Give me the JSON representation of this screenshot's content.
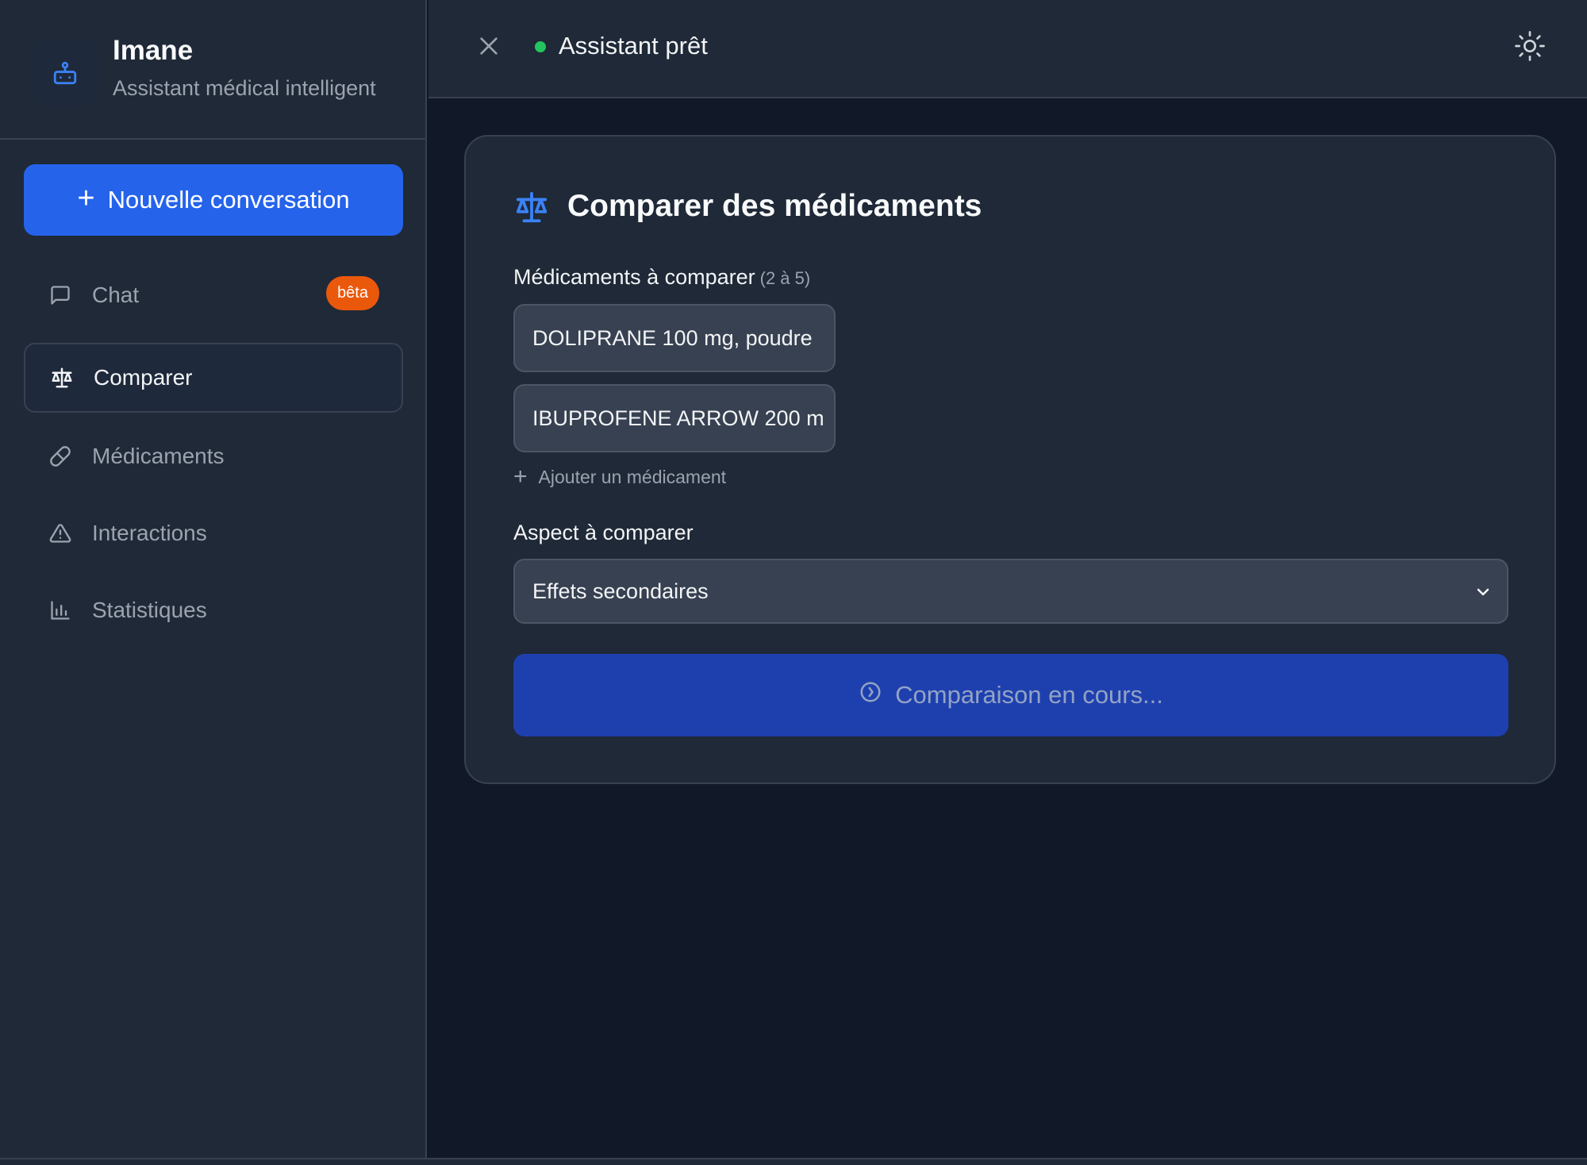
{
  "brand": {
    "name": "Imane",
    "subtitle": "Assistant médical intelligent",
    "logo_icon": "robot-icon"
  },
  "sidebar": {
    "new_button_label": "Nouvelle conversation",
    "items": [
      {
        "label": "Chat",
        "icon": "chat-bubble-icon",
        "badge": "bêta",
        "active": false
      },
      {
        "label": "Comparer",
        "icon": "scale-icon",
        "active": true
      },
      {
        "label": "Médicaments",
        "icon": "pill-icon",
        "active": false
      },
      {
        "label": "Interactions",
        "icon": "warning-triangle-icon",
        "active": false
      },
      {
        "label": "Statistiques",
        "icon": "bar-chart-icon",
        "active": false
      }
    ]
  },
  "header": {
    "status_text": "Assistant prêt",
    "status_color": "#22c55e"
  },
  "compare": {
    "title": "Comparer des médicaments",
    "meds_label": "Médicaments à comparer",
    "meds_hint": "(2 à 5)",
    "medications": [
      "DOLIPRANE 100 mg, poudre",
      "IBUPROFENE ARROW 200 m"
    ],
    "add_label": "Ajouter un médicament",
    "aspect_label": "Aspect à comparer",
    "aspect_value": "Effets secondaires",
    "submit_label": "Comparaison en cours..."
  },
  "colors": {
    "accent": "#2563eb",
    "badge": "#ea580c",
    "background": "#111827",
    "panel": "#1f2937"
  }
}
